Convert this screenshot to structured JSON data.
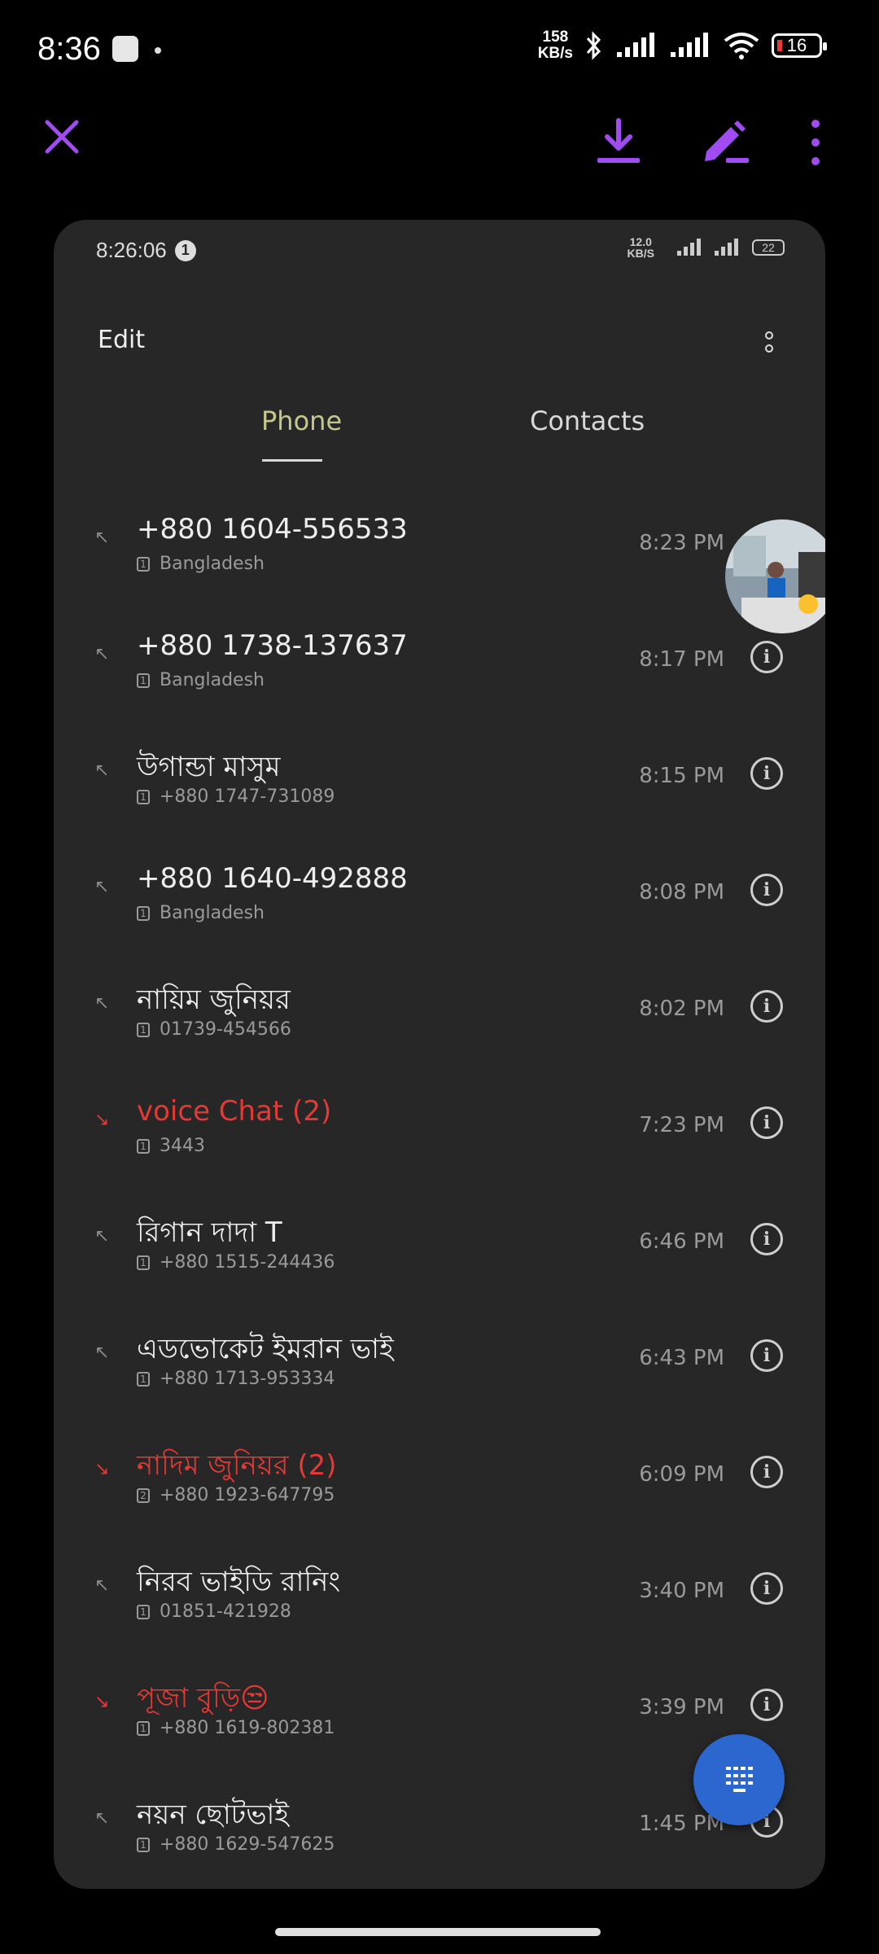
{
  "status_bar": {
    "time": "8:36",
    "net_speed_value": "158",
    "net_speed_unit": "KB/s",
    "battery": "16"
  },
  "action_bar": {
    "icons": [
      "close-icon",
      "download-icon",
      "edit-icon",
      "more-vert-icon"
    ],
    "accent": "#a14cf2"
  },
  "inner_status": {
    "time": "8:26:06",
    "badge": "1",
    "net_value": "12.0",
    "net_unit": "KB/S",
    "battery": "22"
  },
  "header": {
    "edit_label": "Edit"
  },
  "tabs": [
    {
      "label": "Phone",
      "active": true
    },
    {
      "label": "Contacts",
      "active": false
    }
  ],
  "calls": [
    {
      "name": "+880 1604-556533",
      "sim": "1",
      "detail": "Bangladesh",
      "time": "8:23 PM",
      "type": "outgoing",
      "missed": false
    },
    {
      "name": "+880 1738-137637",
      "sim": "1",
      "detail": "Bangladesh",
      "time": "8:17 PM",
      "type": "outgoing",
      "missed": false
    },
    {
      "name": "উগান্ডা মাসুম",
      "sim": "1",
      "detail": "+880 1747-731089",
      "time": "8:15 PM",
      "type": "outgoing",
      "missed": false
    },
    {
      "name": "+880 1640-492888",
      "sim": "1",
      "detail": "Bangladesh",
      "time": "8:08 PM",
      "type": "outgoing",
      "missed": false
    },
    {
      "name": "নায়িম জুনিয়র",
      "sim": "1",
      "detail": "01739-454566",
      "time": "8:02 PM",
      "type": "outgoing",
      "missed": false
    },
    {
      "name": "voice Chat (2)",
      "sim": "1",
      "detail": "3443",
      "time": "7:23 PM",
      "type": "missed",
      "missed": true
    },
    {
      "name": "রিগান দাদা T",
      "sim": "1",
      "detail": "+880 1515-244436",
      "time": "6:46 PM",
      "type": "outgoing",
      "missed": false
    },
    {
      "name": "এডভোকেট ইমরান ভাই",
      "sim": "1",
      "detail": "+880 1713-953334",
      "time": "6:43 PM",
      "type": "outgoing",
      "missed": false
    },
    {
      "name": "নাদিম জুনিয়র (2)",
      "sim": "2",
      "detail": "+880 1923-647795",
      "time": "6:09 PM",
      "type": "missed",
      "missed": true
    },
    {
      "name": "নিরব ভাইডি রানিং",
      "sim": "1",
      "detail": "01851-421928",
      "time": "3:40 PM",
      "type": "outgoing",
      "missed": false
    },
    {
      "name": "পূজা বুড়ি😒",
      "sim": "1",
      "detail": "+880 1619-802381",
      "time": "3:39 PM",
      "type": "missed",
      "missed": true
    },
    {
      "name": "নয়ন ছোটভাই",
      "sim": "1",
      "detail": "+880 1629-547625",
      "time": "1:45 PM",
      "type": "outgoing",
      "missed": false
    }
  ],
  "colors": {
    "missed": "#e53935",
    "tab_active": "#c6c78c",
    "fab": "#2c66cf"
  }
}
